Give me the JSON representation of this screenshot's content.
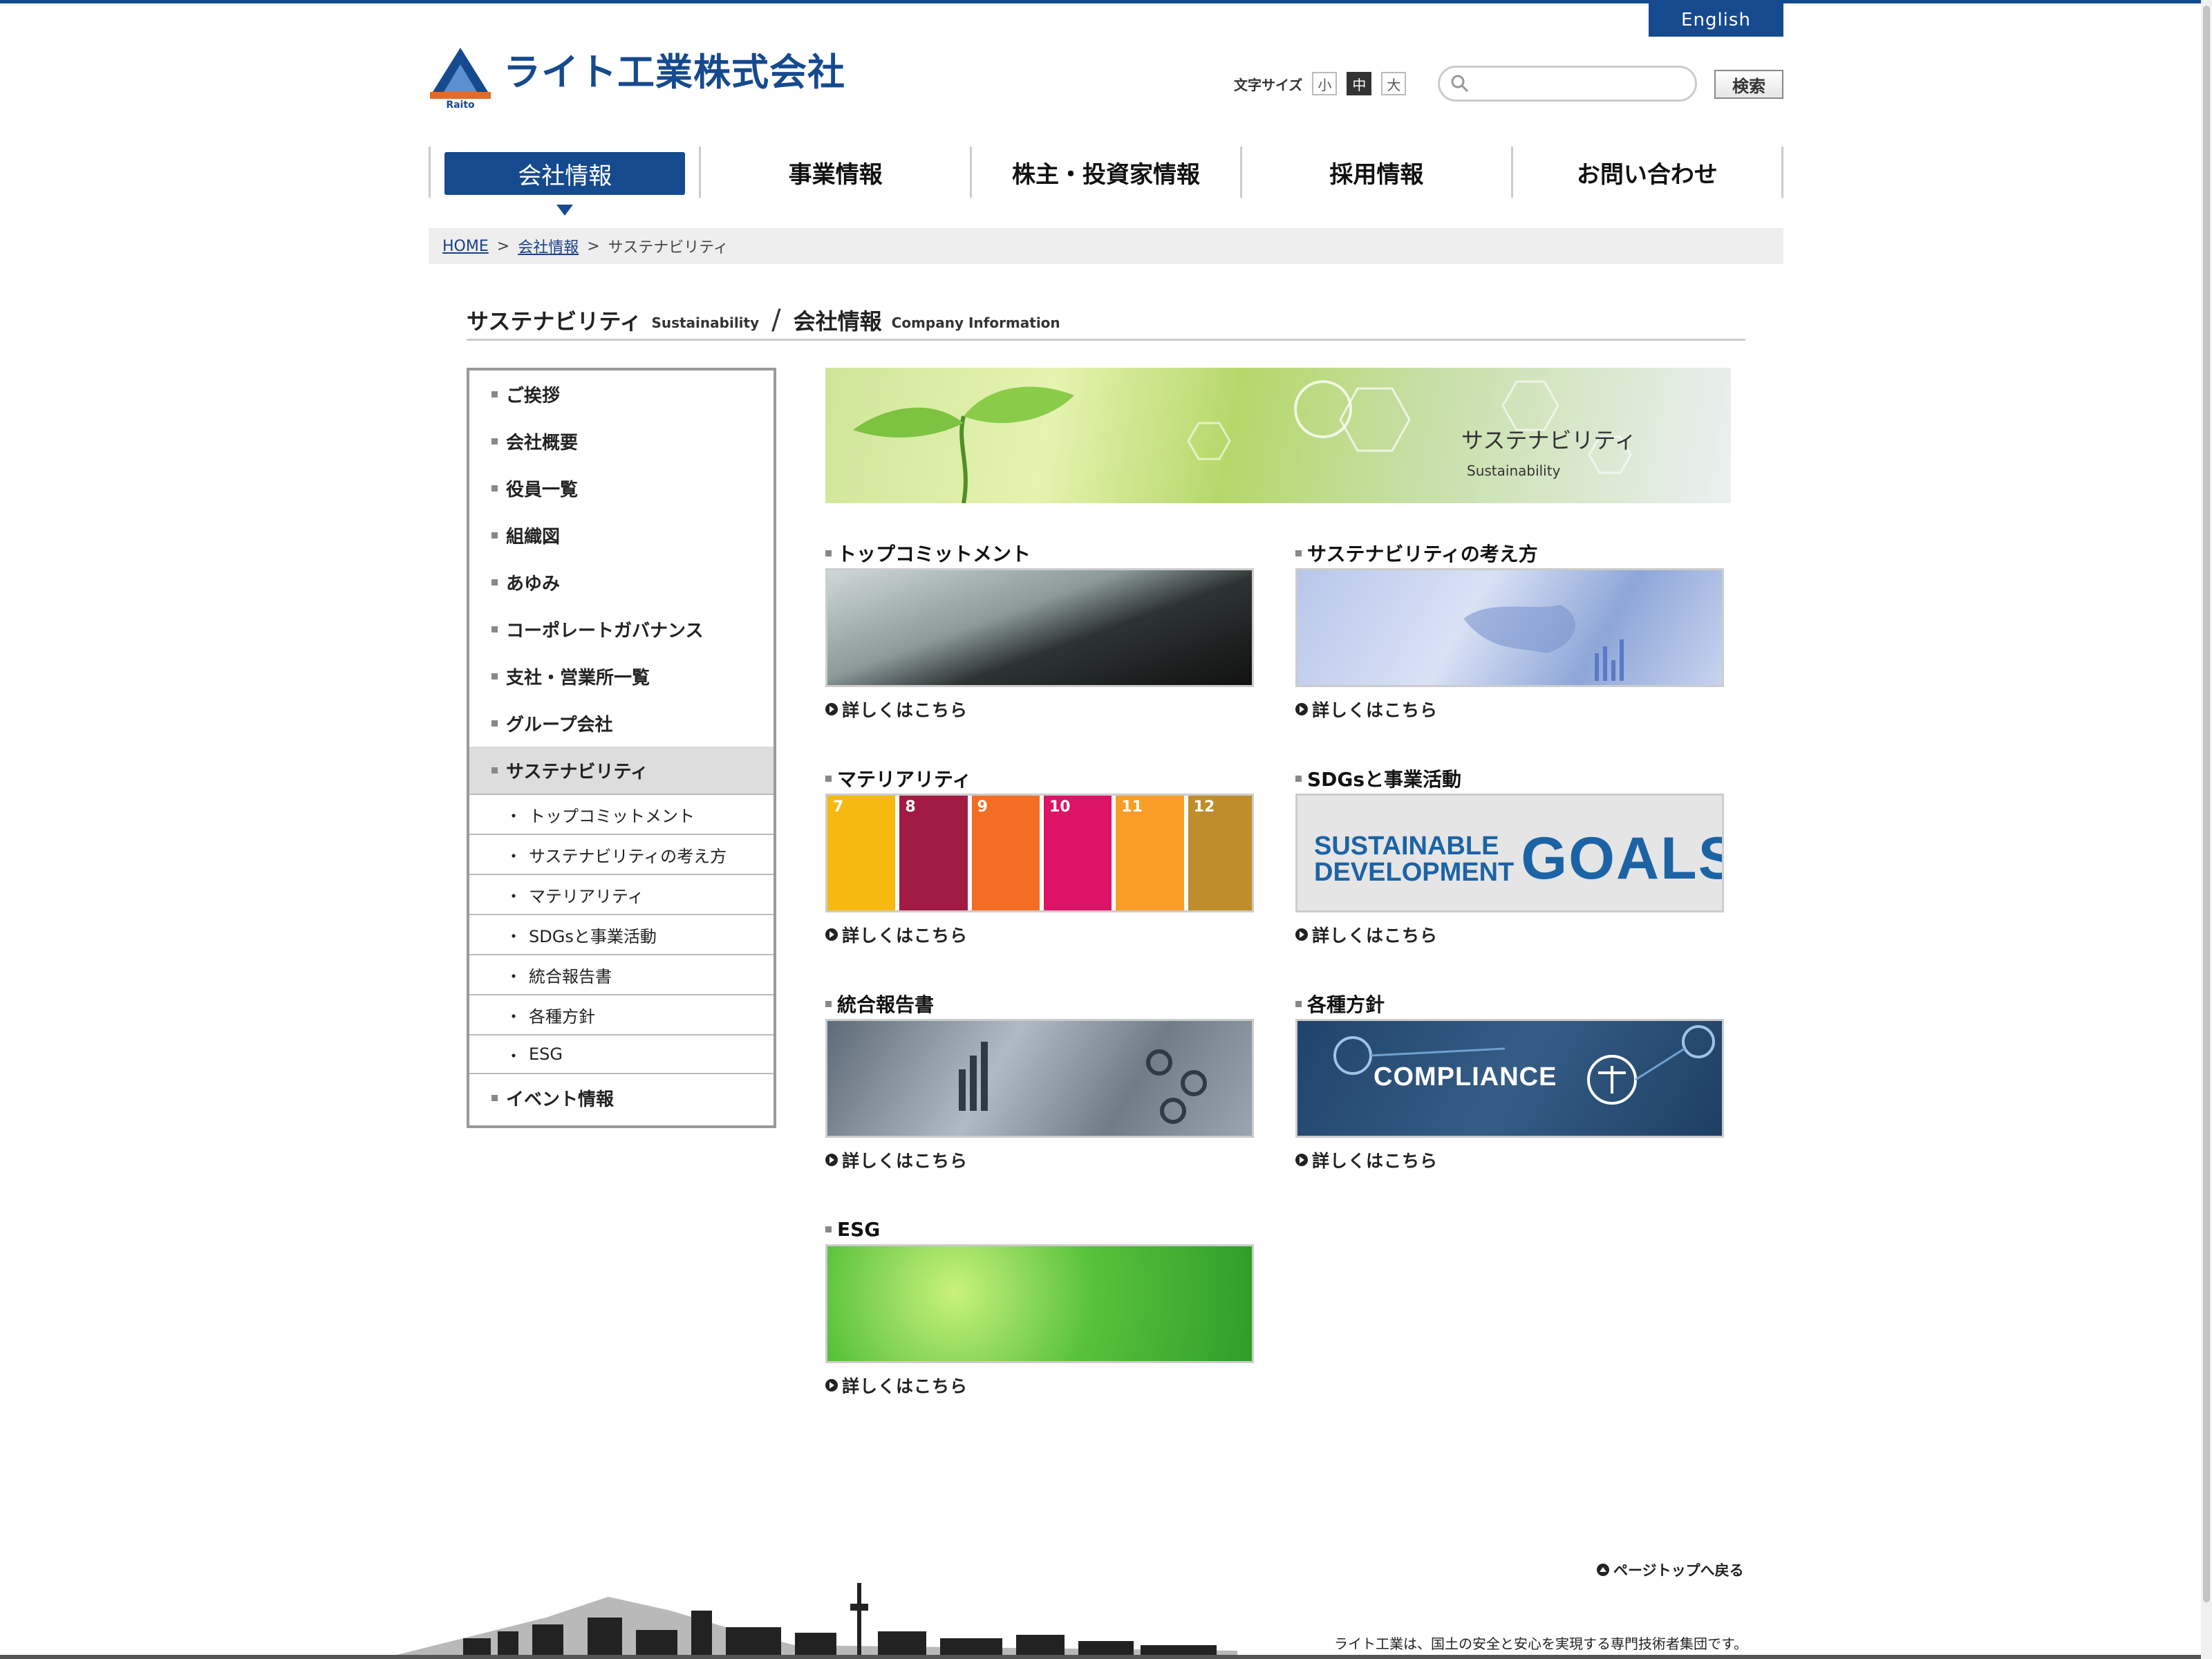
{
  "header": {
    "english_label": "English",
    "logo_text": "ライト工業株式会社",
    "logo_sub": "Raito",
    "fontsize_label": "文字サイズ",
    "fontsize_options": [
      "小",
      "中",
      "大"
    ],
    "fontsize_selected": "中",
    "search_placeholder": "",
    "search_button": "検索"
  },
  "nav": {
    "items": [
      {
        "label": "会社情報",
        "active": true
      },
      {
        "label": "事業情報"
      },
      {
        "label": "株主・投資家情報"
      },
      {
        "label": "採用情報"
      },
      {
        "label": "お問い合わせ"
      }
    ]
  },
  "breadcrumb": {
    "items": [
      "HOME",
      "会社情報",
      "サステナビリティ"
    ],
    "separator": ">"
  },
  "page_title": {
    "jp": "サステナビリティ",
    "en": "Sustainability",
    "slash": "/",
    "parent_jp": "会社情報",
    "parent_en": "Company Information"
  },
  "sidemenu": {
    "items": [
      "ご挨拶",
      "会社概要",
      "役員一覧",
      "組織図",
      "あゆみ",
      "コーポレートガバナンス",
      "支社・営業所一覧",
      "グループ会社",
      "サステナビリティ"
    ],
    "sub_items": [
      "トップコミットメント",
      "サステナビリティの考え方",
      "マテリアリティ",
      "SDGsと事業活動",
      "統合報告書",
      "各種方針",
      "ESG"
    ],
    "last_item": "イベント情報",
    "sub_dot": "・"
  },
  "hero": {
    "title_jp": "サステナビリティ",
    "title_en": "Sustainability"
  },
  "cards": [
    {
      "title": "トップコミットメント",
      "more": "詳しくはこちら"
    },
    {
      "title": "サステナビリティの考え方",
      "more": "詳しくはこちら"
    },
    {
      "title": "マテリアリティ",
      "more": "詳しくはこちら"
    },
    {
      "title": "SDGsと事業活動",
      "more": "詳しくはこちら"
    },
    {
      "title": "統合報告書",
      "more": "詳しくはこちら"
    },
    {
      "title": "各種方針",
      "more": "詳しくはこちら"
    },
    {
      "title": "ESG",
      "more": "詳しくはこちら"
    }
  ],
  "sdg_tiles": [
    {
      "num": "7",
      "color": "#f6b90f"
    },
    {
      "num": "8",
      "color": "#a21b44"
    },
    {
      "num": "9",
      "color": "#f36d25"
    },
    {
      "num": "10",
      "color": "#dd1367"
    },
    {
      "num": "11",
      "color": "#f89d28"
    },
    {
      "num": "12",
      "color": "#bf8d2c"
    }
  ],
  "sdg_logo": {
    "line1": "SUSTAINABLE",
    "line2": "DEVELOPMENT",
    "goals": "GOALS"
  },
  "compliance_text": "COMPLIANCE",
  "footer": {
    "pagetop": "ページトップへ戻る",
    "tagline": "ライト工業は、国土の安全と安心を実現する専門技術者集団です。"
  },
  "colors": {
    "brand_blue": "#164a8f",
    "logo_orange": "#e36a2a"
  }
}
